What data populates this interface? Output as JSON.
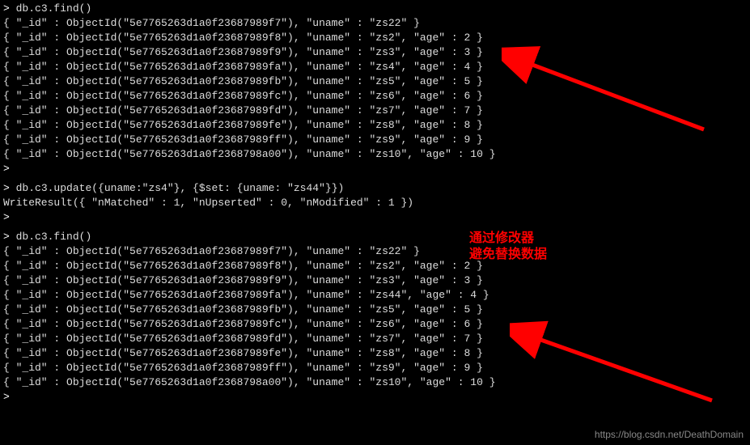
{
  "cmd1": "db.c3.find()",
  "result1": [
    "{ \"_id\" : ObjectId(\"5e7765263d1a0f23687989f7\"), \"uname\" : \"zs22\" }",
    "{ \"_id\" : ObjectId(\"5e7765263d1a0f23687989f8\"), \"uname\" : \"zs2\", \"age\" : 2 }",
    "{ \"_id\" : ObjectId(\"5e7765263d1a0f23687989f9\"), \"uname\" : \"zs3\", \"age\" : 3 }",
    "{ \"_id\" : ObjectId(\"5e7765263d1a0f23687989fa\"), \"uname\" : \"zs4\", \"age\" : 4 }",
    "{ \"_id\" : ObjectId(\"5e7765263d1a0f23687989fb\"), \"uname\" : \"zs5\", \"age\" : 5 }",
    "{ \"_id\" : ObjectId(\"5e7765263d1a0f23687989fc\"), \"uname\" : \"zs6\", \"age\" : 6 }",
    "{ \"_id\" : ObjectId(\"5e7765263d1a0f23687989fd\"), \"uname\" : \"zs7\", \"age\" : 7 }",
    "{ \"_id\" : ObjectId(\"5e7765263d1a0f23687989fe\"), \"uname\" : \"zs8\", \"age\" : 8 }",
    "{ \"_id\" : ObjectId(\"5e7765263d1a0f23687989ff\"), \"uname\" : \"zs9\", \"age\" : 9 }",
    "{ \"_id\" : ObjectId(\"5e7765263d1a0f2368798a00\"), \"uname\" : \"zs10\", \"age\" : 10 }"
  ],
  "cmd2": "db.c3.update({uname:\"zs4\"}, {$set: {uname: \"zs44\"}})",
  "result2": "WriteResult({ \"nMatched\" : 1, \"nUpserted\" : 0, \"nModified\" : 1 })",
  "cmd3": "db.c3.find()",
  "result3": [
    "{ \"_id\" : ObjectId(\"5e7765263d1a0f23687989f7\"), \"uname\" : \"zs22\" }",
    "{ \"_id\" : ObjectId(\"5e7765263d1a0f23687989f8\"), \"uname\" : \"zs2\", \"age\" : 2 }",
    "{ \"_id\" : ObjectId(\"5e7765263d1a0f23687989f9\"), \"uname\" : \"zs3\", \"age\" : 3 }",
    "{ \"_id\" : ObjectId(\"5e7765263d1a0f23687989fa\"), \"uname\" : \"zs44\", \"age\" : 4 }",
    "{ \"_id\" : ObjectId(\"5e7765263d1a0f23687989fb\"), \"uname\" : \"zs5\", \"age\" : 5 }",
    "{ \"_id\" : ObjectId(\"5e7765263d1a0f23687989fc\"), \"uname\" : \"zs6\", \"age\" : 6 }",
    "{ \"_id\" : ObjectId(\"5e7765263d1a0f23687989fd\"), \"uname\" : \"zs7\", \"age\" : 7 }",
    "{ \"_id\" : ObjectId(\"5e7765263d1a0f23687989fe\"), \"uname\" : \"zs8\", \"age\" : 8 }",
    "{ \"_id\" : ObjectId(\"5e7765263d1a0f23687989ff\"), \"uname\" : \"zs9\", \"age\" : 9 }",
    "{ \"_id\" : ObjectId(\"5e7765263d1a0f2368798a00\"), \"uname\" : \"zs10\", \"age\" : 10 }"
  ],
  "comment_line1": "通过修改器",
  "comment_line2": "避免替换数据",
  "prompt": ">",
  "watermark": "https://blog.csdn.net/DeathDomain"
}
